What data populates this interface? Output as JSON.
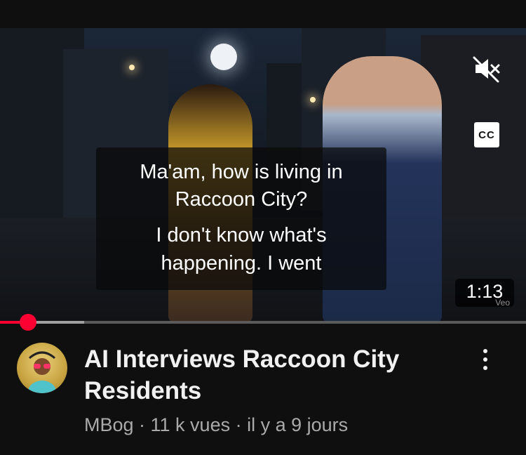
{
  "video": {
    "captions": [
      "Ma'am, how is living in",
      "Raccoon City?",
      "I don't know what's",
      "happening. I went"
    ],
    "duration": "1:13",
    "watermark": "Veo",
    "cc_label": "CC",
    "mute_icon": "speaker-muted-icon",
    "progress": 0.053,
    "buffered": 0.16
  },
  "details": {
    "title": "AI Interviews Raccoon City Residents",
    "meta": "MBog · 11 k vues · il y a 9 jours",
    "more_icon": "vertical-dots-icon"
  },
  "colors": {
    "accent": "#ff0033",
    "background": "#0f0f0f",
    "title": "#f1f1f1",
    "meta": "#aaaaaa"
  }
}
